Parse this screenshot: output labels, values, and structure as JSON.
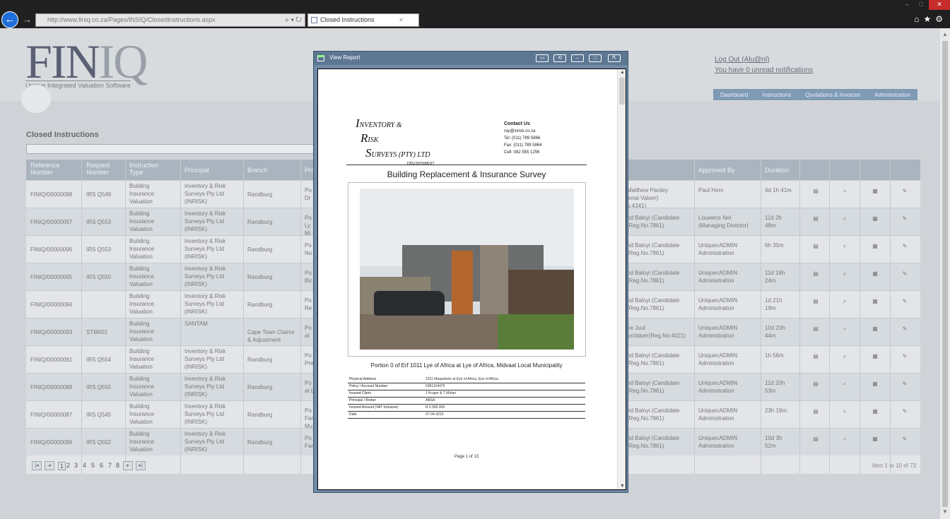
{
  "browser": {
    "url": "http://www.finiq.co.za/Pages/INSIQ/ClosedInstructions.aspx",
    "tab_title": "Closed Instructions",
    "tab_close": "×",
    "back_icon": "←",
    "forward_icon": "→",
    "addr_icons": "⌕ ▾ ↻",
    "win_min": "–",
    "win_max": "□",
    "win_close": "✕",
    "tool_icons": "⌂★⚙",
    "scroll_up": "▲",
    "scroll_down": "▼"
  },
  "header": {
    "logo_text": "FIN",
    "logo_q": "IQ",
    "tagline": "Unique Integrated Valuation Software",
    "logout": "Log Out (Alu@nl)",
    "notifications": "You have 0 unread notifications"
  },
  "nav": [
    "Dashboard",
    "Instructions",
    "Quotations & Invoices",
    "Administration"
  ],
  "section_title": "Closed Instructions",
  "grid": {
    "headers": {
      "ref": "Reference\nNumber",
      "req": "Request\nNumber",
      "typ": "Instruction\nType",
      "pri": "Principal",
      "br": "Branch",
      "pr": "Pro",
      "val": "r",
      "app": "Approved By",
      "dur": "Duration"
    },
    "rows": [
      {
        "ref": "FINIQ/00000098",
        "req": "IRS Q549",
        "typ": "Building\nInsurance\nValuation",
        "pri": "Inventory & Risk\nSurveys Pty Ltd\n(INRISK)",
        "br": "Randburg",
        "pr": "Po\nDr",
        "val": "Matthew Pardey\nional Valuer)\no.4341)",
        "app": "Paul Horn",
        "dur": "4d 1h 41m"
      },
      {
        "ref": "FINIQ/00000097",
        "req": "IRS Q553",
        "typ": "Building\nInsurance\nValuation",
        "pri": "Inventory & Risk\nSurveys Pty Ltd\n(INRISK)",
        "br": "Randburg",
        "pr": "Po\nLy\nMi",
        "val": "nd Baloyi (Candidate\n(Reg.No.7861)",
        "app": "Louwens Nel\n(Managing Director)",
        "dur": "11d 2h\n48m"
      },
      {
        "ref": "FINIQ/00000096",
        "req": "IRS Q553",
        "typ": "Building\nInsurance\nValuation",
        "pri": "Inventory & Risk\nSurveys Pty Ltd\n(INRISK)",
        "br": "Randburg",
        "pr": "Po\nNo",
        "val": "nd Baloyi (Candidate\n(Reg.No.7861)",
        "app": "UniquecADMIN\nAdministration",
        "dur": "6h 35m"
      },
      {
        "ref": "FINIQ/00000095",
        "req": "IRS Q550",
        "typ": "Building\nInsurance\nValuation",
        "pri": "Inventory & Risk\nSurveys Pty Ltd\n(INRISK)",
        "br": "Randburg",
        "pr": "Po\nBic",
        "val": "nd Baloyi (Candidate\n(Reg.No.7861)",
        "app": "UniquecADMIN\nAdministration",
        "dur": "11d 18h\n24m"
      },
      {
        "ref": "FINIQ/00000094",
        "req": "",
        "typ": "Building\nInsurance\nValuation",
        "pri": "Inventory & Risk\nSurveys Pty Ltd\n(INRISK)",
        "br": "Randburg",
        "pr": "Po\nRe",
        "val": "nd Baloyi (Candidate\n(Reg.No.7861)",
        "app": "UniquecADMIN\nAdministration",
        "dur": "1d 21h\n19m"
      },
      {
        "ref": "FINIQ/00000093",
        "req": "STM001",
        "typ": "Building\nInsurance\nValuation",
        "pri": "SANTAM",
        "br": "Cape Town Claims\n& Adjustment",
        "pr": "Po\nat",
        "val": "ne Juul\nssValuer(Reg.No.4021)",
        "app": "UniquecADMIN\nAdministration",
        "dur": "10d 23h\n44m"
      },
      {
        "ref": "FINIQ/00000091",
        "req": "IRS Q554",
        "typ": "Building\nInsurance\nValuation",
        "pri": "Inventory & Risk\nSurveys Pty Ltd\n(INRISK)",
        "br": "Randburg",
        "pr": "Po\nPre",
        "val": "nd Baloyi (Candidate\n(Reg.No.7861)",
        "app": "UniquecADMIN\nAdministration",
        "dur": "1h 56m"
      },
      {
        "ref": "FINIQ/00000088",
        "req": "IRS Q555",
        "typ": "Building\nInsurance\nValuation",
        "pri": "Inventory & Risk\nSurveys Pty Ltd\n(INRISK)",
        "br": "Randburg",
        "pr": "Po\nat L",
        "val": "nd Baloyi (Candidate\n(Reg.No.7861)",
        "app": "UniquecADMIN\nAdministration",
        "dur": "11d 20h\n53m"
      },
      {
        "ref": "FINIQ/00000087",
        "req": "IRS Q545",
        "typ": "Building\nInsurance\nValuation",
        "pri": "Inventory & Risk\nSurveys Pty Ltd\n(INRISK)",
        "br": "Randburg",
        "pr": "Po\nFar\nMu",
        "val": "nd Baloyi (Candidate\n(Reg.No.7861)",
        "app": "UniquecADMIN\nAdministration",
        "dur": "23h 19m"
      },
      {
        "ref": "FINIQ/00000086",
        "req": "IRS Q552",
        "typ": "Building\nInsurance\nValuation",
        "pri": "Inventory & Risk\nSurveys Pty Ltd\n(INRISK)",
        "br": "Randburg",
        "pr": "Po\nFar",
        "val": "nd Baloyi (Candidate\n(Reg.No.7861)",
        "app": "UniquecADMIN\nAdministration",
        "dur": "10d 3h\n52m"
      }
    ],
    "action_icons": {
      "report": "▤",
      "view": "⌕",
      "summary": "▦",
      "edit": "✎"
    }
  },
  "pager": {
    "first": "|◂",
    "prev": "◂",
    "next": "▸",
    "last": "▸|",
    "pages": [
      "1",
      "2",
      "3",
      "4",
      "5",
      "6",
      "7",
      "8"
    ],
    "info": "Item 1 to 10 of 73"
  },
  "modal": {
    "title": "View Report",
    "btn1": "▭",
    "btn2": "⟲",
    "btn3": "–",
    "btn4": "□",
    "btn5": "⇱",
    "scroll_up": "▲",
    "scroll_down": "▼"
  },
  "report": {
    "company_l1": "NVENTORY &",
    "company_i": "I",
    "company_r": "R",
    "company_l2": "ISK",
    "company_s": "S",
    "company_l3": "URVEYS (PTY) LTD",
    "company_reg": "1992/005688/07",
    "contact_title": "Contact Us",
    "contact_email": "ray@inrisk.co.za",
    "contact_tel": "Tel:     (011) 789 5866",
    "contact_fax": "Fax:     (011) 789 5864",
    "contact_cell": "Cell:     082 555 1256",
    "title": "Building Replacement & Insurance Survey",
    "caption": "Portion 0 of Erf 1011 Lye of Africa at Lye of Africa, Midvaal Local Municipality",
    "table": [
      {
        "label": "Physical Address",
        "value": "1011 Maqeebelo at Eye of Africa, Eye of Africa"
      },
      {
        "label": "Policy / Account Number",
        "value": "0381164475"
      },
      {
        "label": "Insured Client",
        "value": "J Kruger & T Molao"
      },
      {
        "label": "Principal / Broker",
        "value": "ABSA"
      },
      {
        "label": "Insured Amount (VAT Inclusive)",
        "value": "R 6 580 000"
      },
      {
        "label": "Date",
        "value": "07-04-2015"
      }
    ],
    "page": "Page 1 of 13"
  }
}
